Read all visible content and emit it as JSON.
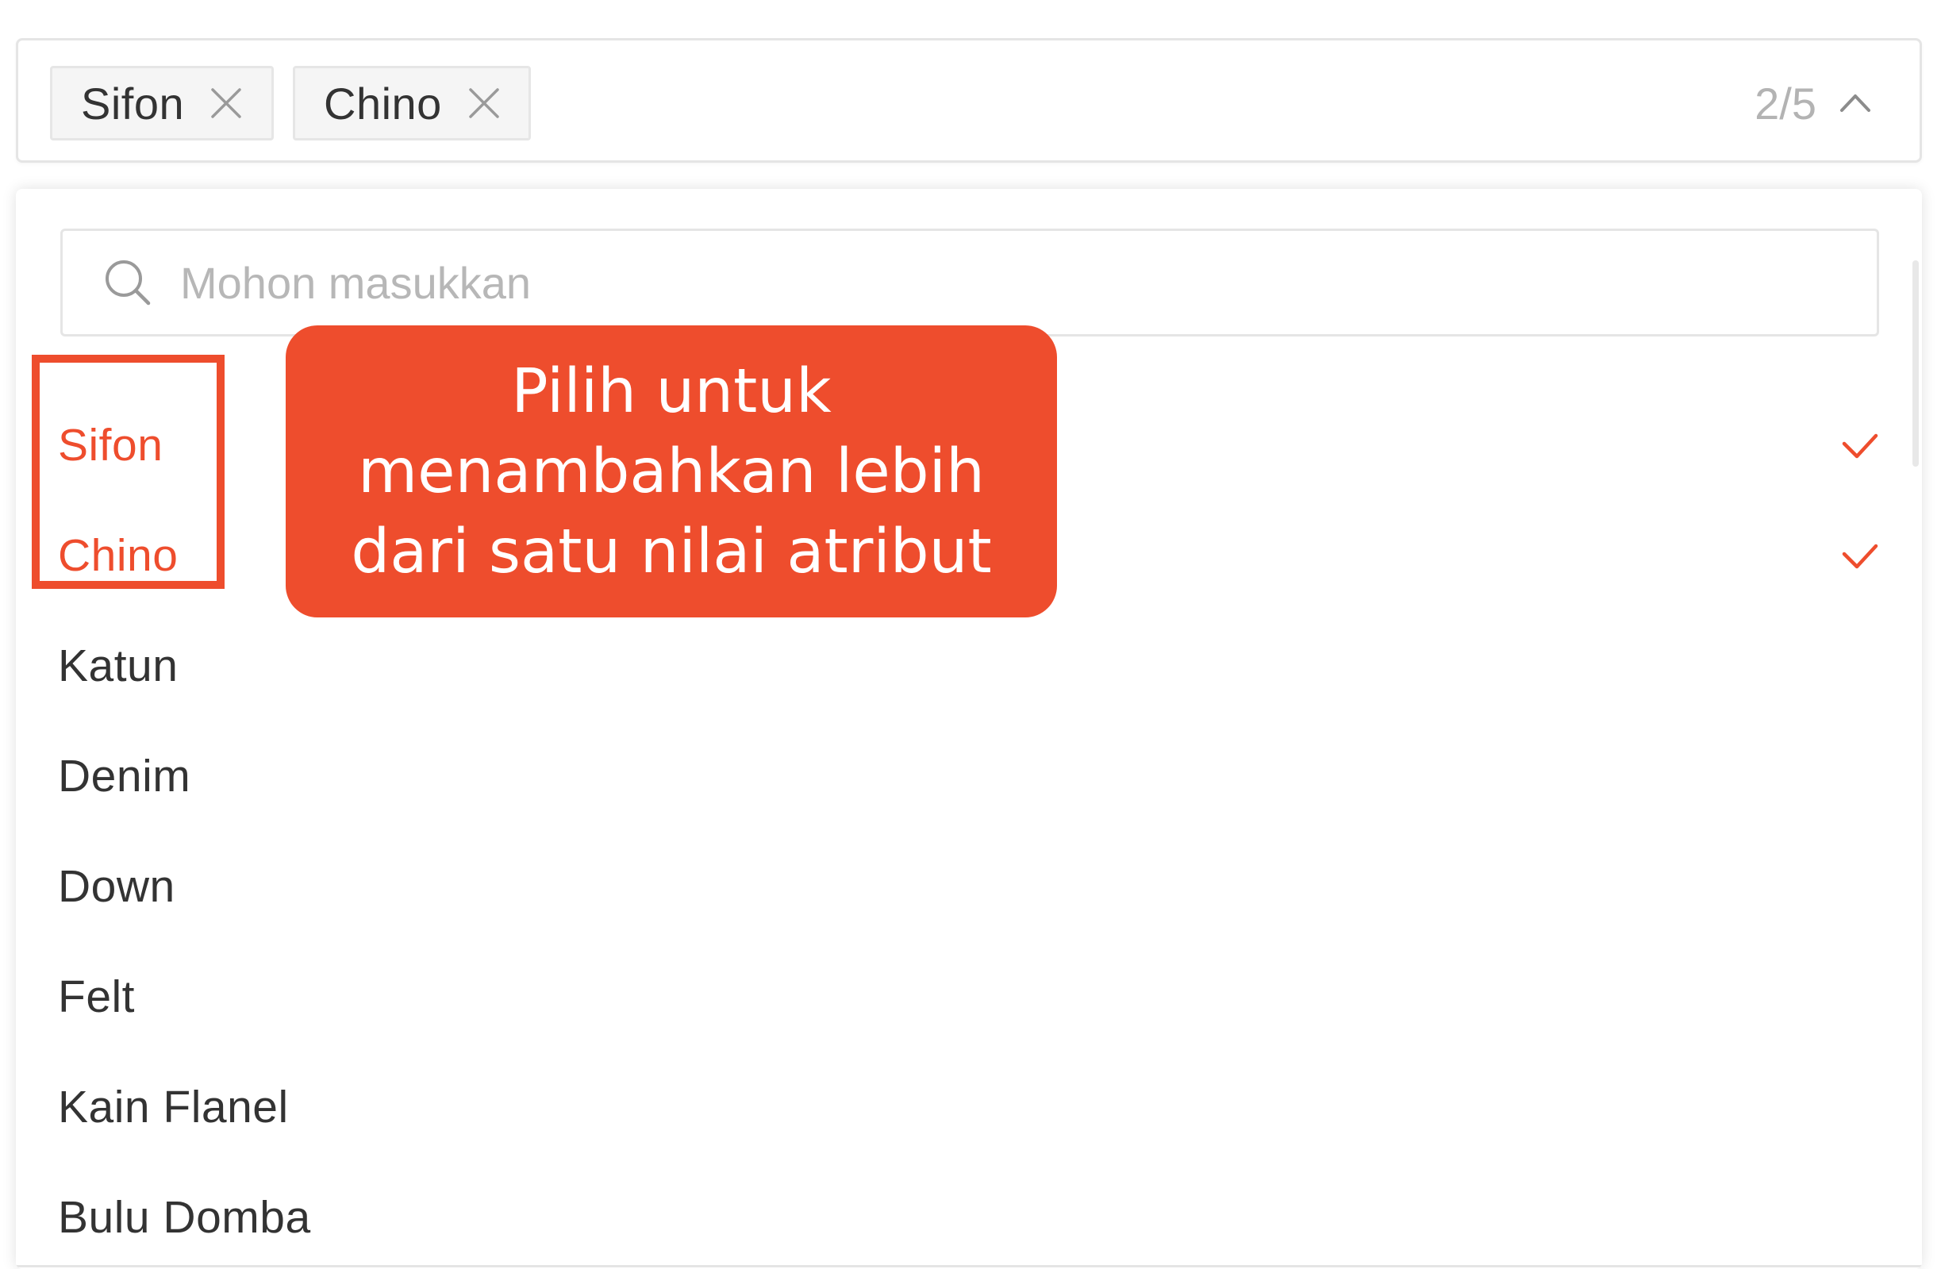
{
  "select": {
    "tags": [
      {
        "label": "Sifon"
      },
      {
        "label": "Chino"
      }
    ],
    "counter": "2/5"
  },
  "dropdown": {
    "search": {
      "placeholder": "Mohon masukkan",
      "value": ""
    },
    "options": [
      {
        "label": "Sifon",
        "selected": true
      },
      {
        "label": "Chino",
        "selected": true
      },
      {
        "label": "Katun",
        "selected": false
      },
      {
        "label": "Denim",
        "selected": false
      },
      {
        "label": "Down",
        "selected": false
      },
      {
        "label": "Felt",
        "selected": false
      },
      {
        "label": "Kain Flanel",
        "selected": false
      },
      {
        "label": "Bulu Domba",
        "selected": false
      }
    ]
  },
  "callout": {
    "text": "Pilih untuk\nmenambahkan lebih\ndari satu nilai atribut"
  },
  "colors": {
    "accent": "#ee4d2d",
    "text": "#333333",
    "muted": "#b3b3b3",
    "border": "#e5e5e5"
  },
  "icons": {
    "tag_close": "close-icon",
    "toggle": "chevron-up-icon",
    "search": "search-icon",
    "selected": "check-icon"
  }
}
